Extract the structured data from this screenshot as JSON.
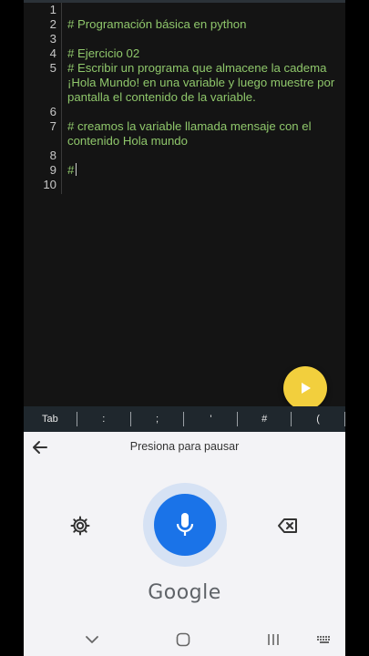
{
  "editor": {
    "lines": [
      {
        "num": "1",
        "text": ""
      },
      {
        "num": "2",
        "text": "# Programación básica en python"
      },
      {
        "num": "3",
        "text": ""
      },
      {
        "num": "4",
        "text": "# Ejercicio 02"
      },
      {
        "num": "5",
        "text": "# Escribir un programa que almacene la cadema"
      },
      {
        "num": "",
        "text": "¡Hola Mundo! en una variable y luego muestre por"
      },
      {
        "num": "",
        "text": "pantalla el contenido de la variable."
      },
      {
        "num": "6",
        "text": ""
      },
      {
        "num": "7",
        "text": "# creamos la variable llamada mensaje con el"
      },
      {
        "num": "",
        "text": "contenido Hola mundo"
      },
      {
        "num": "8",
        "text": ""
      },
      {
        "num": "9",
        "text": "#"
      },
      {
        "num": "10",
        "text": ""
      }
    ],
    "code_color": "#8fc76b"
  },
  "run_button": {
    "icon": "play-icon",
    "color": "#f2cf3d"
  },
  "keybar": {
    "keys": [
      "Tab",
      ":",
      ";",
      "'",
      "#",
      "("
    ]
  },
  "voice_input": {
    "hint": "Presiona para pausar",
    "brand": "Google",
    "mic_color": "#1a73e8",
    "icons": [
      "back-arrow-icon",
      "gear-icon",
      "microphone-icon",
      "backspace-icon"
    ]
  },
  "navigation": {
    "icons": [
      "chevron-down-icon",
      "home-icon",
      "recents-icon",
      "keyboard-icon"
    ]
  }
}
